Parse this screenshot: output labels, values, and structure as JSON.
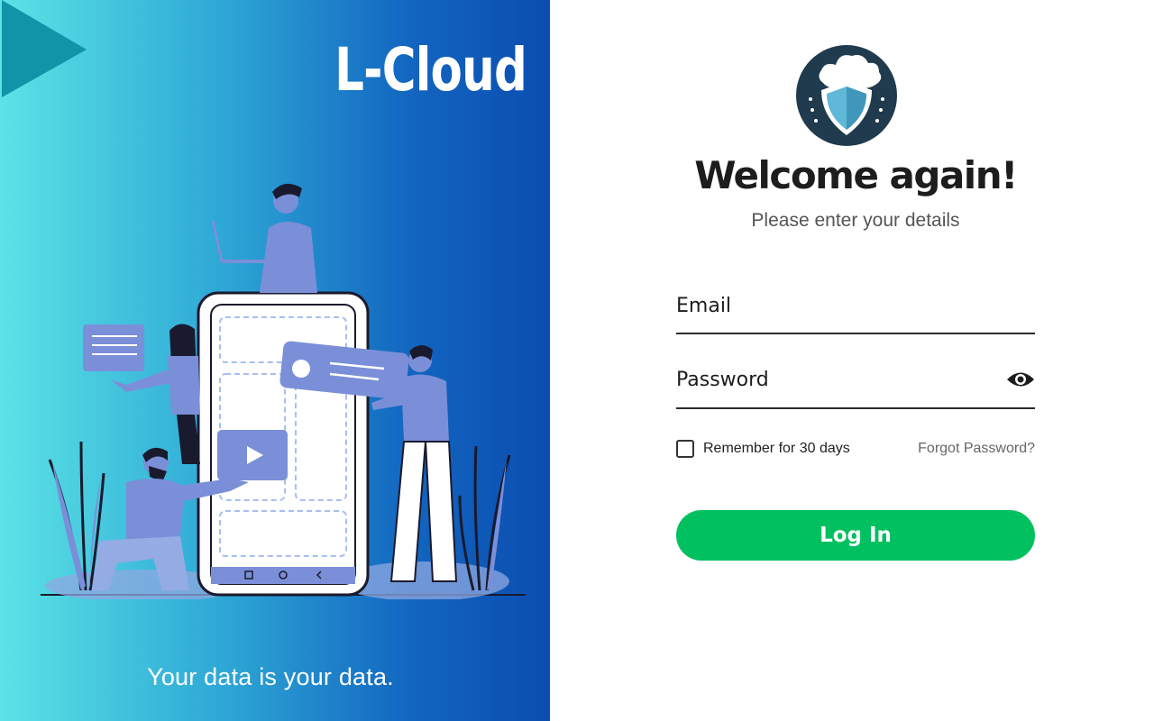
{
  "brand": {
    "title": "L-Cloud",
    "tagline": "Your data is your data."
  },
  "login": {
    "heading": "Welcome again!",
    "subtitle": "Please enter your details",
    "email_placeholder": "Email",
    "password_placeholder": "Password",
    "remember_label": "Remember for 30 days",
    "forgot_label": "Forgot Password?",
    "login_label": "Log In"
  },
  "icons": {
    "logo": "cloud-shield-logo",
    "password_toggle": "eye-icon",
    "decor": "play-triangle-icon"
  },
  "colors": {
    "gradient_start": "#5be3e6",
    "gradient_end": "#0b4db0",
    "primary_button": "#00c060",
    "logo_bg": "#1f3b4d",
    "shield": "#5fb8d8"
  }
}
